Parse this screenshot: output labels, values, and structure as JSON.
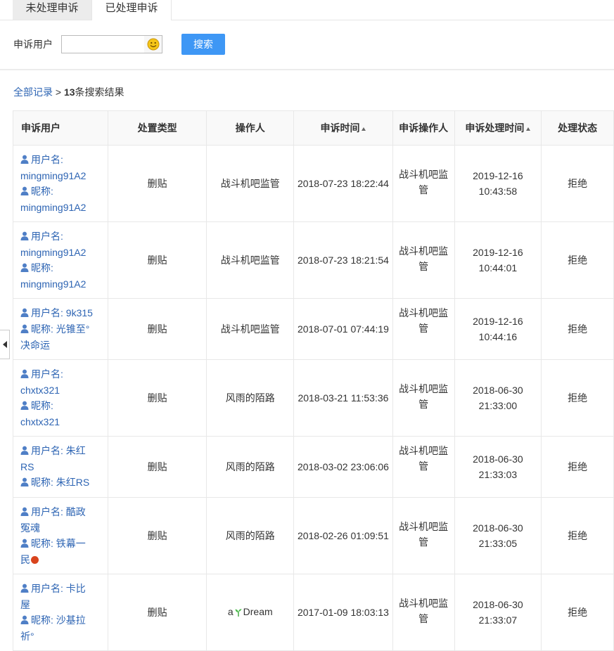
{
  "tabs": [
    {
      "label": "未处理申诉",
      "active": false
    },
    {
      "label": "已处理申诉",
      "active": true
    }
  ],
  "search": {
    "label": "申诉用户",
    "value": "",
    "placeholder": "",
    "emoji_icon": "smiley-icon",
    "button_label": "搜索",
    "button_color": "#3e97f5"
  },
  "breadcrumb": {
    "all_records": "全部记录",
    "separator": " > ",
    "count": "13",
    "suffix": "条搜索结果"
  },
  "table": {
    "headers": {
      "user": "申诉用户",
      "type": "处置类型",
      "operator": "操作人",
      "appeal_time": "申诉时间",
      "appeal_operator": "申诉操作人",
      "process_time": "申诉处理时间",
      "status": "处理状态"
    },
    "rows": [
      {
        "username_label": "用户名:",
        "username": "mingming91A2",
        "nick_label": "昵称:",
        "nickname": "mingming91A2",
        "type": "删贴",
        "operator": "战斗机吧监管",
        "appeal_time": "2018-07-23 18:22:44",
        "appeal_op_1": "战斗机吧监",
        "appeal_op_2": "管",
        "process_date": "2019-12-16",
        "process_clock": "10:43:58",
        "status": "拒绝"
      },
      {
        "username_label": "用户名:",
        "username": "mingming91A2",
        "nick_label": "昵称:",
        "nickname": "mingming91A2",
        "type": "删贴",
        "operator": "战斗机吧监管",
        "appeal_time": "2018-07-23 18:21:54",
        "appeal_op_1": "战斗机吧监",
        "appeal_op_2": "管",
        "process_date": "2019-12-16",
        "process_clock": "10:44:01",
        "status": "拒绝"
      },
      {
        "username_label": "用户名: 9k315",
        "username": "",
        "nick_label": "昵称: 光锥至°",
        "nickname": "决命运",
        "type": "删贴",
        "operator": "战斗机吧监管",
        "appeal_time": "2018-07-01 07:44:19",
        "appeal_op_1": "战斗机吧监",
        "appeal_op_2": "管",
        "process_date": "2019-12-16",
        "process_clock": "10:44:16",
        "status": "拒绝"
      },
      {
        "username_label": "用户名:",
        "username": "chxtx321",
        "nick_label": "昵称:",
        "nickname": "chxtx321",
        "type": "删贴",
        "operator": "风雨的陌路",
        "appeal_time": "2018-03-21 11:53:36",
        "appeal_op_1": "战斗机吧监",
        "appeal_op_2": "管",
        "process_date": "2018-06-30",
        "process_clock": "21:33:00",
        "status": "拒绝"
      },
      {
        "username_label": "用户名: 朱红",
        "username": "RS",
        "nick_label": "昵称: 朱红RS",
        "nickname": "",
        "type": "删贴",
        "operator": "风雨的陌路",
        "appeal_time": "2018-03-02 23:06:06",
        "appeal_op_1": "战斗机吧监",
        "appeal_op_2": "管",
        "process_date": "2018-06-30",
        "process_clock": "21:33:03",
        "status": "拒绝"
      },
      {
        "username_label": "用户名: 酷政",
        "username": "冤魂",
        "nick_label": "昵称: 铁幕一",
        "nickname": "民",
        "type": "删贴",
        "operator": "风雨的陌路",
        "appeal_time": "2018-02-26 01:09:51",
        "appeal_op_1": "战斗机吧监",
        "appeal_op_2": "管",
        "process_date": "2018-06-30",
        "process_clock": "21:33:05",
        "status": "拒绝"
      },
      {
        "username_label": "用户名: 卡比",
        "username": "屋",
        "nick_label": "昵称: 沙基拉",
        "nickname": "祈°",
        "type": "删贴",
        "operator_a": "a",
        "operator_b": "Dream",
        "appeal_time": "2017-01-09 18:03:13",
        "appeal_op_1": "战斗机吧监",
        "appeal_op_2": "管",
        "process_date": "2018-06-30",
        "process_clock": "21:33:07",
        "status": "拒绝"
      }
    ]
  },
  "colors": {
    "link": "#2d64b3",
    "accent": "#3e97f5"
  }
}
